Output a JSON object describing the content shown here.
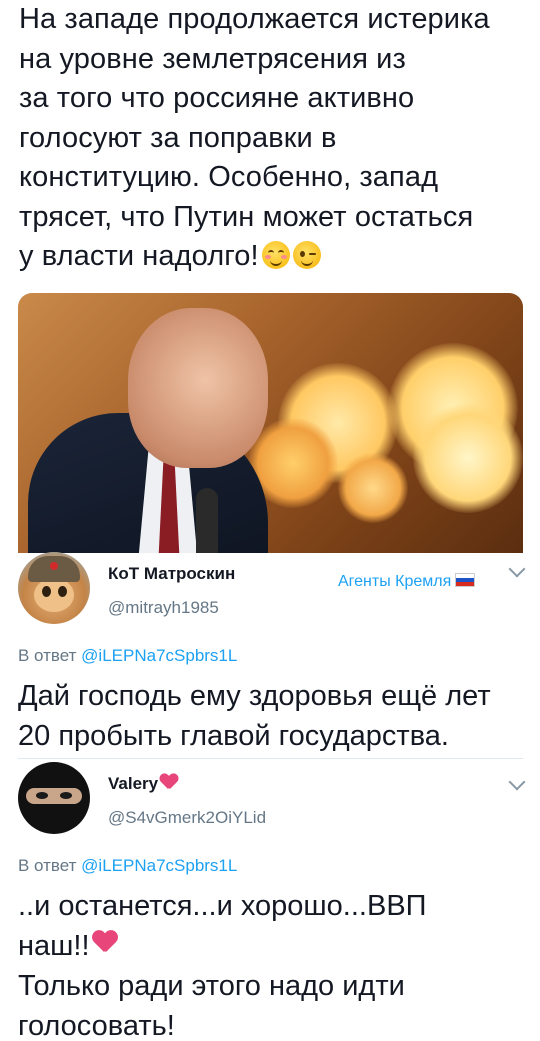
{
  "post": {
    "text": "На западе продолжается истерика\nна уровне землетрясения из\nза того что россияне активно\nголосуют за поправки в\nконституцию.  Особенно, запад\nтрясет, что Путин может остаться\nу власти надолго!",
    "emojis": [
      "smiling-face-with-smiling-eyes",
      "winking-face"
    ]
  },
  "reply1": {
    "author_name": "КоТ Матроскин",
    "author_handle": "@mitrayh1985",
    "label": "Агенты Кремля",
    "label_flag": "russia-flag",
    "reply_to_prefix": "В ответ ",
    "reply_to_mention": "@iLEPNa7cSpbrs1L",
    "text": "Дай господь ему здоровья ещё лет\n20 пробыть главой государства."
  },
  "reply2": {
    "author_name": "Valery",
    "author_handle": "@S4vGmerk2OiYLid",
    "reply_to_prefix": "В ответ ",
    "reply_to_mention": "@iLEPNa7cSpbrs1L",
    "text_line1": "..и останется...и хорошо...ВВП",
    "text_line2": "наш!!",
    "text_line3": "Только ради этого надо идти\nголосовать!"
  },
  "colors": {
    "link": "#1da1f2",
    "secondary_text": "#657786",
    "text": "#141823"
  }
}
